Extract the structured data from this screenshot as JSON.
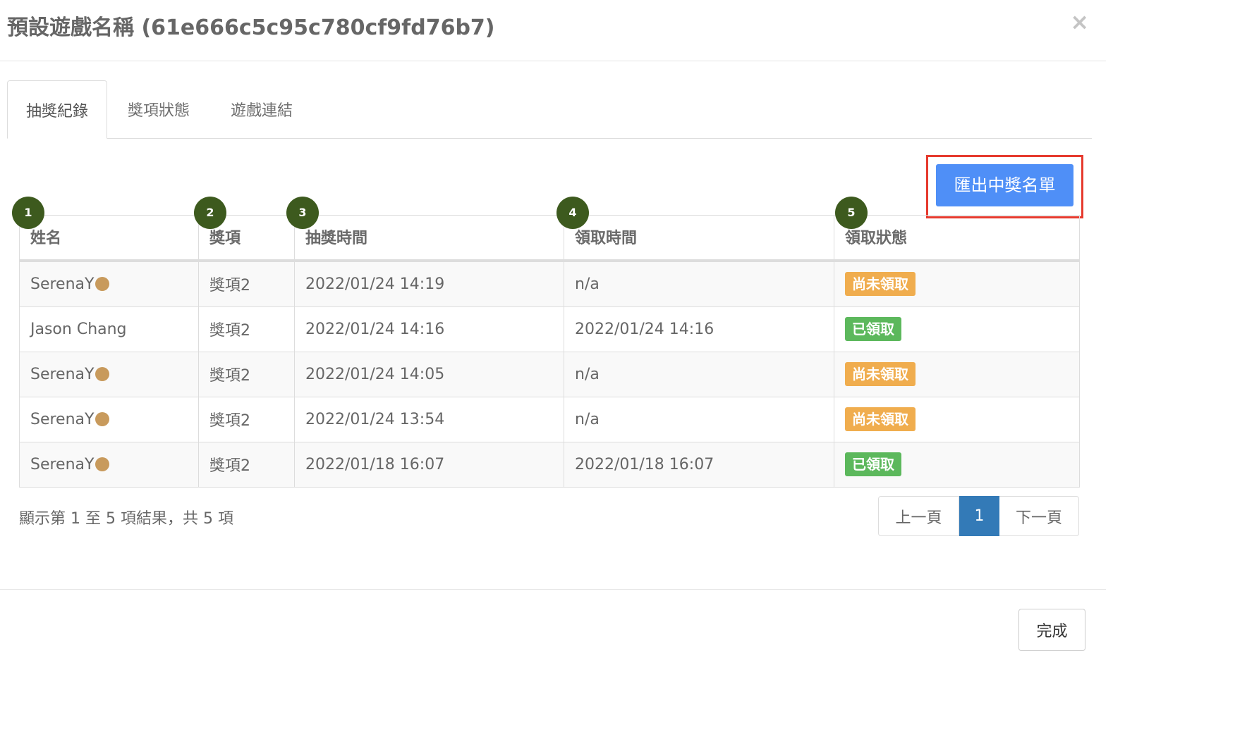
{
  "modal": {
    "title": "預設遊戲名稱 (61e666c5c95c780cf9fd76b7)",
    "close_symbol": "×"
  },
  "tabs": [
    {
      "label": "抽獎紀錄",
      "active": true
    },
    {
      "label": "獎項狀態",
      "active": false
    },
    {
      "label": "遊戲連結",
      "active": false
    }
  ],
  "export_button": "匯出中獎名單",
  "markers": [
    "1",
    "2",
    "3",
    "4",
    "5"
  ],
  "table": {
    "headers": [
      "姓名",
      "獎項",
      "抽獎時間",
      "領取時間",
      "領取狀態"
    ],
    "rows": [
      {
        "name": "SerenaY",
        "has_icon": true,
        "prize": "獎項2",
        "draw_time": "2022/01/24 14:19",
        "claim_time": "n/a",
        "status": "尚未領取",
        "status_type": "pending"
      },
      {
        "name": "Jason Chang",
        "has_icon": false,
        "prize": "獎項2",
        "draw_time": "2022/01/24 14:16",
        "claim_time": "2022/01/24 14:16",
        "status": "已領取",
        "status_type": "claimed"
      },
      {
        "name": "SerenaY",
        "has_icon": true,
        "prize": "獎項2",
        "draw_time": "2022/01/24 14:05",
        "claim_time": "n/a",
        "status": "尚未領取",
        "status_type": "pending"
      },
      {
        "name": "SerenaY",
        "has_icon": true,
        "prize": "獎項2",
        "draw_time": "2022/01/24 13:54",
        "claim_time": "n/a",
        "status": "尚未領取",
        "status_type": "pending"
      },
      {
        "name": "SerenaY",
        "has_icon": true,
        "prize": "獎項2",
        "draw_time": "2022/01/18 16:07",
        "claim_time": "2022/01/18 16:07",
        "status": "已領取",
        "status_type": "claimed"
      }
    ]
  },
  "info_text": "顯示第 1 至 5 項結果，共 5 項",
  "pagination": {
    "prev": "上一頁",
    "current": "1",
    "next": "下一頁"
  },
  "footer": {
    "done": "完成"
  },
  "colors": {
    "badge_pending": "#f0ad4e",
    "badge_claimed": "#5cb85c",
    "export_button": "#4f8ff7",
    "highlight_frame": "#e63a2e",
    "marker": "#3d5a1e",
    "page_active": "#337ab7"
  },
  "icons": {
    "name_icon": "monkey-emoji-icon"
  }
}
